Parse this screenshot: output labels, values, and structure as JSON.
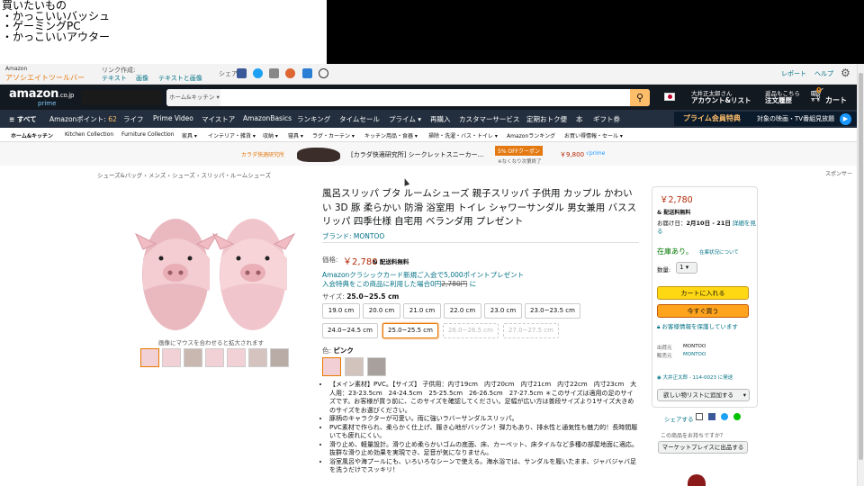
{
  "note": {
    "lines": [
      "買いたいもの",
      "・かっこいいバッシュ",
      "・ゲーミングPC",
      "・かっこいいアウター"
    ]
  },
  "assoc": {
    "brand": "Amazon",
    "title": "アソシエイトツールバー",
    "link_label": "リンク作成:",
    "text": "テキスト",
    "image": "画像",
    "text_image": "テキストと画像",
    "share": "シェア:",
    "report": "レポート",
    "help": "ヘルプ"
  },
  "header": {
    "logo": "amazon",
    "logo_jp": ".co.jp",
    "prime": "prime",
    "search_category": "ホーム&キッチン",
    "account_top": "大井正太郎さん",
    "account_bottom": "アカウント&リスト",
    "orders_top": "返品もこちら",
    "orders_bottom": "注文履歴",
    "cart_count": "0",
    "cart": "カート"
  },
  "nav": {
    "items": [
      "≡ すべて",
      "Amazonポイント:",
      "ライフ",
      "Prime Video",
      "マイストア",
      "AmazonBasics",
      "ランキング",
      "タイムセール",
      "プライム ▾",
      "再購入",
      "カスタマーサービス",
      "定期おトク便",
      "本",
      "ギフト券"
    ],
    "points": "62",
    "prime_banner": "プライム会員特典",
    "prime_sub": "対象の映画・TV番組見放題"
  },
  "subnav": [
    "ホーム&キッチン",
    "Kitchen Collection",
    "Furniture Collection",
    "家具 ▾",
    "インテリア・雑貨 ▾",
    "収納 ▾",
    "寝具 ▾",
    "ラグ・カーテン ▾",
    "キッチン用品・食器 ▾",
    "掃除・洗濯・バス・トイレ ▾",
    "Amazonランキング",
    "お買い得情報・セール ▾"
  ],
  "promo": {
    "brand": "カラダ快適研究所",
    "title": "[カラダ快適研究所] シークレットスニーカー...",
    "coupon": "5% OFFクーポン",
    "coupon_sub": "※なくなり次第終了",
    "price": "￥9,800",
    "prime": "√prime",
    "sponsor": "スポンサー"
  },
  "breadcrumb": "シューズ&バッグ › メンズ › シューズ › スリッパ・ルームシューズ",
  "image_hint": "画像にマウスを合わせると拡大されます",
  "product": {
    "title": "風呂スリッパ ブタ ルームシューズ 親子スリッパ 子供用 カップル かわいい 3D 豚 柔らかい 防滑 浴室用 トイレ シャワーサンダル 男女兼用 バススリッパ 四季仕様 自宅用 ベランダ用 プレゼント",
    "brand": "ブランド: MONTOO",
    "price_label": "価格:",
    "price": "￥2,780",
    "shipping": "& 配送料無料",
    "card_promo": "Amazonクラシックカード新規ご入会で5,000ポイントプレゼント",
    "card_promo2": "入会特典をこの商品に利用した場合0円",
    "old_price": "2,780円",
    "card_promo3": "に",
    "size_label": "サイズ:",
    "size_value": "25.0~25.5 cm",
    "sizes": [
      "19.0 cm",
      "20.0 cm",
      "21.0 cm",
      "22.0 cm",
      "23.0 cm",
      "23.0~23.5 cm",
      "24.0~24.5 cm",
      "25.0~25.5 cm",
      "26.0~26.5 cm",
      "27.0~27.5 cm"
    ],
    "color_label": "色:",
    "color_value": "ピンク",
    "bullets": [
      "【メイン素材】PVC。【サイズ】 子供用：内寸19cm　内寸20cm　内寸21cm　内寸22cm　内寸23cm　大人用：23-23.5cm　24-24.5cm　25-25.5cm　26-26.5cm　27-27.5cm ＊このサイズは適用の足のサイズです。お客様が買う前に、このサイズを確認してください。足幅が広い方は普段サイズより1サイズ大きめのサイズをお選びください。",
      "豚柄のキャラクターが可愛い。雨に強いラバーサンダルスリッパ。",
      "PVC素材で作られ、柔らかく仕上げ、履き心地がバッグン！弾力もあり、排水性と通気性も魅力的！長時間履いても疲れにくい。",
      "滑り止め、軽量設計。滑り止め柔らかいゴムの底面、床、カーペット、床タイルなど多種の部屋地面に適応。抜群な滑り止め効果を実現でき、足音が気になりません。",
      "浴室風呂や海プールにも、いろいろなシーンで使える。海水浴では、サンダルを履いたまま、ジャバジャバ足を洗うだけでスッキリ！"
    ]
  },
  "buybox": {
    "price": "￥2,780",
    "shipping": "& 配送料無料",
    "delivery_label": "お届け日：",
    "delivery": "2月10日 - 21日",
    "detail": "詳細を見る",
    "stock": "在庫あり。",
    "stock_note": "在庫状況について",
    "qty_label": "数量:",
    "qty": "1",
    "cart_btn": "カートに入れる",
    "buy_btn": "今すぐ買う",
    "secure": "お客様情報を保護しています",
    "ship_from_label": "出荷元",
    "ship_from": "MONTOO",
    "seller_label": "販売元",
    "seller": "MONTOO",
    "address": "大井正太郎 - 114-0023 に発送",
    "wishlist": "欲しい物リストに追加する",
    "share": "シェアする",
    "sell_q": "この商品をお持ちですか？",
    "sell_btn": "マーケットプレイスに出品する"
  },
  "colors": {
    "nav": "#131921",
    "nav2": "#232f3e",
    "accent": "#febd69",
    "cart": "#ffd814",
    "buy": "#ffa41c",
    "link": "#007185",
    "price": "#b12704",
    "stock": "#007600"
  }
}
